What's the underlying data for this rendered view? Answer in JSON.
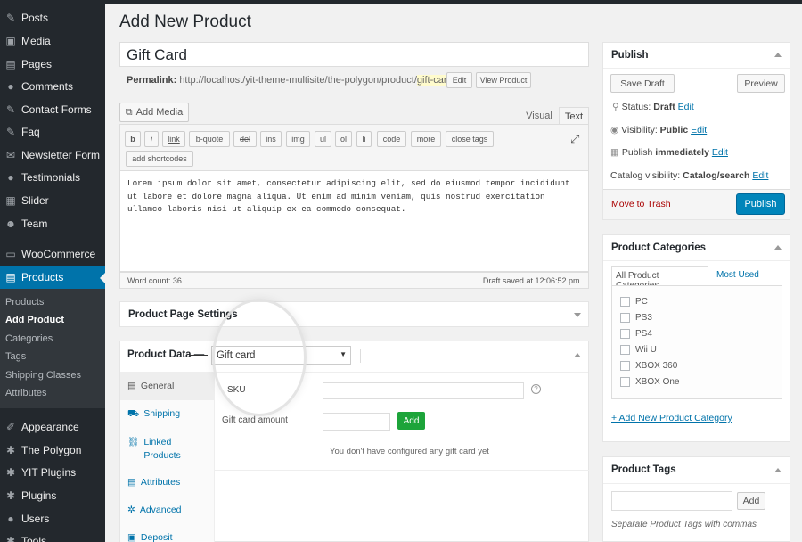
{
  "sidebar": {
    "items": [
      {
        "label": "Posts",
        "icon": "pin-icon"
      },
      {
        "label": "Media",
        "icon": "media-icon"
      },
      {
        "label": "Pages",
        "icon": "pages-icon"
      },
      {
        "label": "Comments",
        "icon": "comment-icon"
      },
      {
        "label": "Contact Forms",
        "icon": "mail-icon"
      },
      {
        "label": "Faq",
        "icon": "pin-icon"
      },
      {
        "label": "Newsletter Form",
        "icon": "mail-icon"
      },
      {
        "label": "Testimonials",
        "icon": "comment-icon"
      },
      {
        "label": "Slider",
        "icon": "slider-icon"
      },
      {
        "label": "Team",
        "icon": "people-icon"
      },
      {
        "label": "WooCommerce",
        "icon": "woo-icon"
      },
      {
        "label": "Products",
        "icon": "products-icon"
      },
      {
        "label": "Appearance",
        "icon": "brush-icon"
      },
      {
        "label": "The Polygon",
        "icon": "gear-icon"
      },
      {
        "label": "YIT Plugins",
        "icon": "plugin-icon"
      },
      {
        "label": "Plugins",
        "icon": "plugin-icon"
      },
      {
        "label": "Users",
        "icon": "user-icon"
      },
      {
        "label": "Tools",
        "icon": "wrench-icon"
      }
    ],
    "submenu": [
      "Products",
      "Add Product",
      "Categories",
      "Tags",
      "Shipping Classes",
      "Attributes"
    ]
  },
  "page": {
    "title": "Add New Product",
    "product_title": "Gift Card",
    "permalink_label": "Permalink:",
    "permalink_url": "http://localhost/yit-theme-multisite/the-polygon/product/",
    "permalink_slug": "gift-card",
    "permalink_end": "/",
    "edit_btn": "Edit",
    "view_btn": "View Product"
  },
  "editor": {
    "add_media": "Add Media",
    "tab_visual": "Visual",
    "tab_text": "Text",
    "quicktags": [
      "b",
      "i",
      "link",
      "b-quote",
      "del",
      "ins",
      "img",
      "ul",
      "ol",
      "li",
      "code",
      "more",
      "close tags"
    ],
    "shortcodes": "add shortcodes",
    "content": "Lorem ipsum dolor sit amet, consectetur adipiscing elit, sed do eiusmod tempor incididunt ut labore et dolore magna aliqua. Ut enim ad minim veniam, quis nostrud exercitation ullamco laboris nisi ut aliquip ex ea commodo consequat.",
    "word_count": "Word count: 36",
    "draft_saved": "Draft saved at 12:06:52 pm."
  },
  "settings": {
    "title": "Product Page Settings"
  },
  "product_data": {
    "title": "Product Data —",
    "type": "Gift card",
    "tabs": [
      "General",
      "Shipping",
      "Linked Products",
      "Attributes",
      "Advanced",
      "Deposit"
    ],
    "sku_label": "SKU",
    "amount_label": "Gift card amount",
    "add_btn": "Add",
    "help": "?",
    "notice": "You don't have configured any gift card yet"
  },
  "publish": {
    "title": "Publish",
    "save_draft": "Save Draft",
    "preview": "Preview",
    "status_label": "Status:",
    "status_value": "Draft",
    "visibility_label": "Visibility:",
    "visibility_value": "Public",
    "publish_label": "Publish",
    "publish_value": "immediately",
    "catalog_label": "Catalog visibility:",
    "catalog_value": "Catalog/search",
    "edit": "Edit",
    "trash": "Move to Trash",
    "publish_btn": "Publish"
  },
  "categories": {
    "title": "Product Categories",
    "tab_all": "All Product Categories",
    "tab_used": "Most Used",
    "items": [
      "PC",
      "PS3",
      "PS4",
      "Wii U",
      "XBOX 360",
      "XBOX One"
    ],
    "add_new": "+ Add New Product Category"
  },
  "tags": {
    "title": "Product Tags",
    "add": "Add",
    "hint": "Separate Product Tags with commas"
  },
  "colors": {
    "sidebar": "#23282d",
    "active": "#0073aa",
    "primary_btn": "#0085ba",
    "add_btn": "#1da43a",
    "trash": "#a00"
  }
}
